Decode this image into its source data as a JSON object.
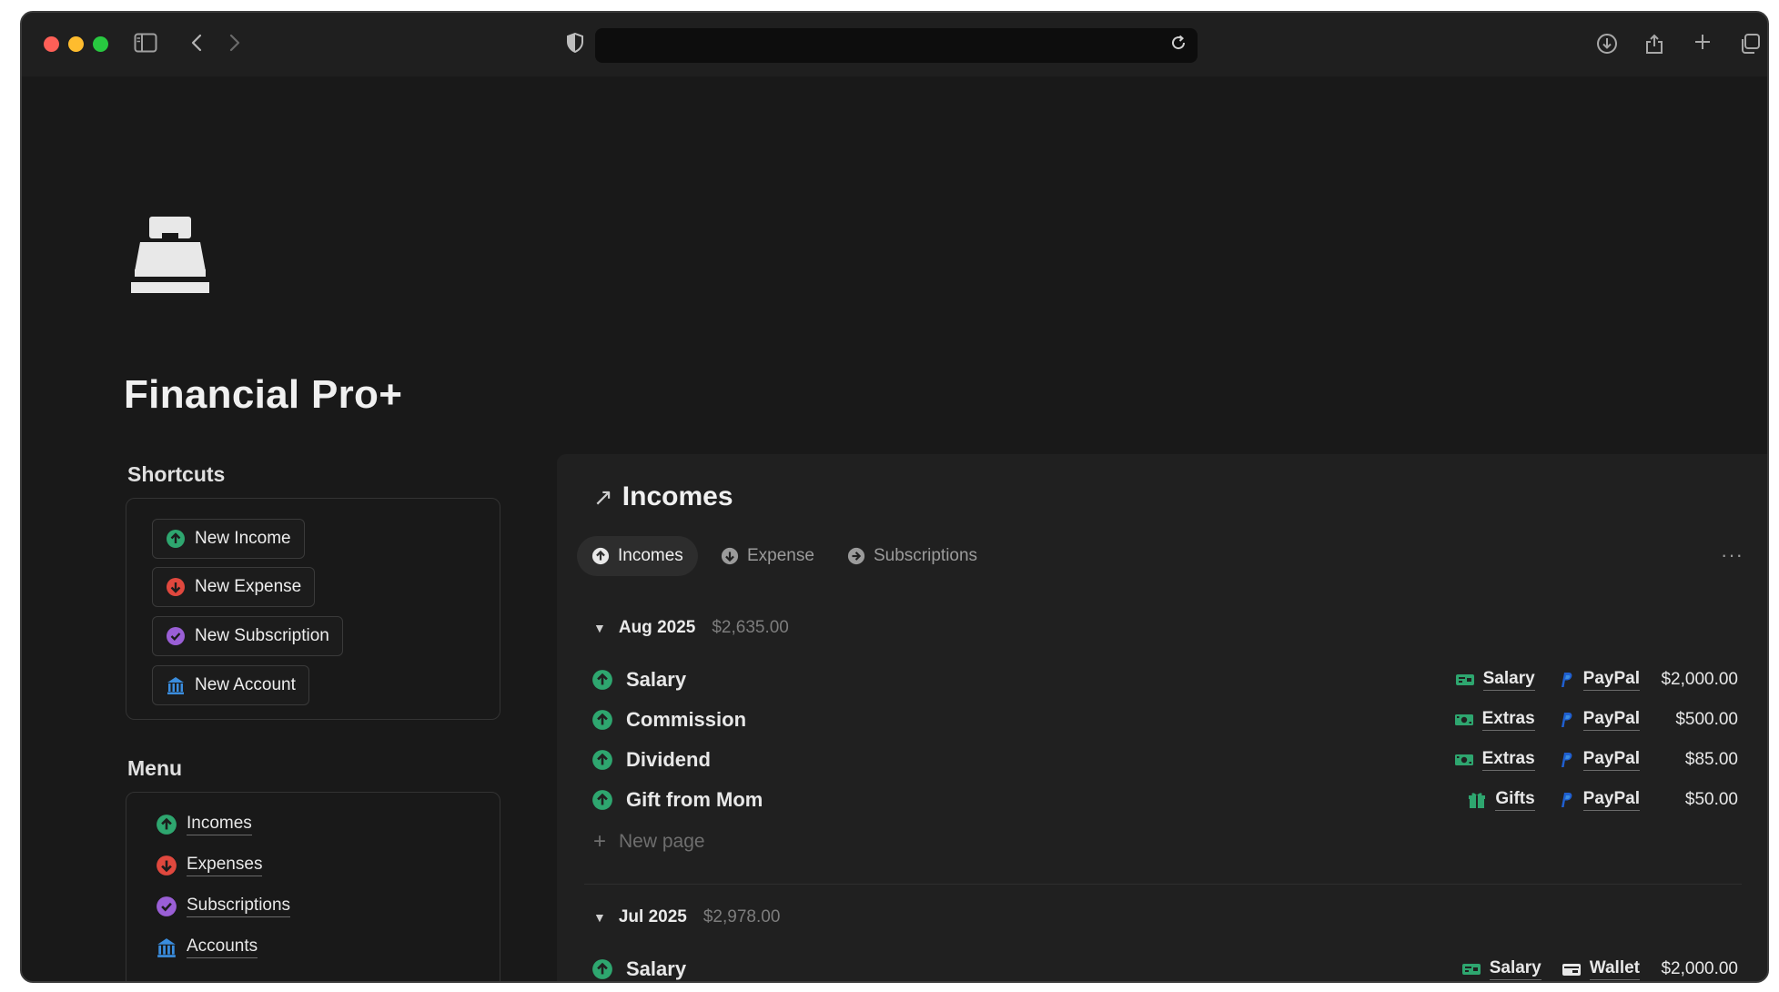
{
  "page": {
    "title": "Financial Pro+",
    "icon": "cash-register-icon"
  },
  "browser": {
    "address": ""
  },
  "shortcuts": {
    "heading": "Shortcuts",
    "buttons": [
      {
        "label": "New Income",
        "icon": "arrow-up-circle-icon",
        "color": "#2ea66f"
      },
      {
        "label": "New Expense",
        "icon": "arrow-down-circle-icon",
        "color": "#e0483e"
      },
      {
        "label": "New Subscription",
        "icon": "check-circle-icon",
        "color": "#9a5fd6"
      },
      {
        "label": "New Account",
        "icon": "bank-icon",
        "color": "#3a8dde"
      }
    ]
  },
  "menu": {
    "heading": "Menu",
    "items": [
      {
        "label": "Incomes",
        "icon": "arrow-up-circle-icon"
      },
      {
        "label": "Expenses",
        "icon": "arrow-down-circle-icon"
      },
      {
        "label": "Subscriptions",
        "icon": "check-circle-icon"
      },
      {
        "label": "Accounts",
        "icon": "bank-icon"
      }
    ]
  },
  "database": {
    "title": "Incomes",
    "tabs": [
      {
        "label": "Incomes",
        "active": true
      },
      {
        "label": "Expense",
        "active": false
      },
      {
        "label": "Subscriptions",
        "active": false
      }
    ],
    "groups": [
      {
        "name": "Aug 2025",
        "total": "$2,635.00",
        "rows": [
          {
            "name": "Salary",
            "category": "Salary",
            "category_icon": "salary-card-icon",
            "account": "PayPal",
            "account_icon": "paypal-icon",
            "amount": "$2,000.00"
          },
          {
            "name": "Commission",
            "category": "Extras",
            "category_icon": "cash-icon",
            "account": "PayPal",
            "account_icon": "paypal-icon",
            "amount": "$500.00"
          },
          {
            "name": "Dividend",
            "category": "Extras",
            "category_icon": "cash-icon",
            "account": "PayPal",
            "account_icon": "paypal-icon",
            "amount": "$85.00"
          },
          {
            "name": "Gift from Mom",
            "category": "Gifts",
            "category_icon": "gift-icon",
            "account": "PayPal",
            "account_icon": "paypal-icon",
            "amount": "$50.00"
          }
        ],
        "new_page_label": "New page"
      },
      {
        "name": "Jul 2025",
        "total": "$2,978.00",
        "rows": [
          {
            "name": "Salary",
            "category": "Salary",
            "category_icon": "salary-card-icon",
            "account": "Wallet",
            "account_icon": "wallet-icon",
            "amount": "$2,000.00"
          }
        ]
      }
    ]
  },
  "colors": {
    "income_green": "#2ea66f",
    "expense_red": "#e0483e",
    "subscription_purple": "#9a5fd6",
    "account_blue": "#3a8dde",
    "paypal_blue": "#1f5fd1"
  }
}
